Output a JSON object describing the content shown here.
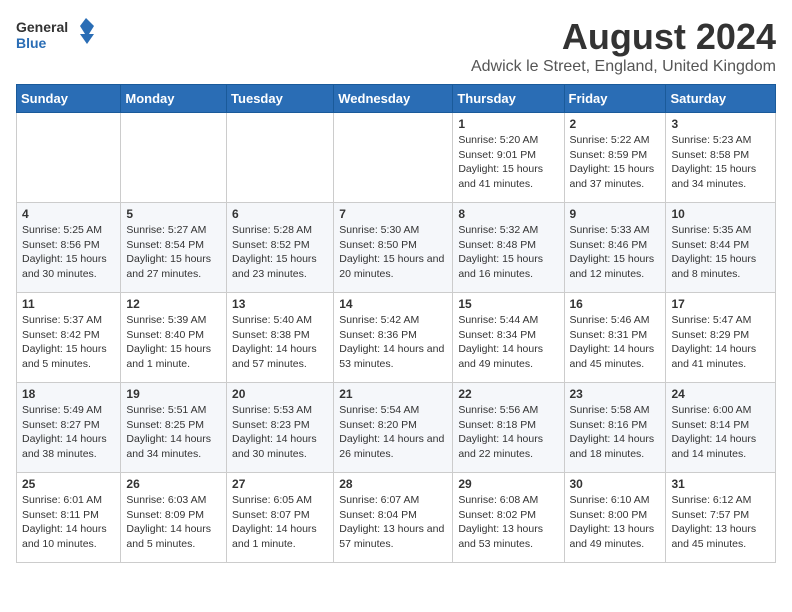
{
  "header": {
    "logo_general": "General",
    "logo_blue": "Blue",
    "main_title": "August 2024",
    "subtitle": "Adwick le Street, England, United Kingdom"
  },
  "calendar": {
    "days_of_week": [
      "Sunday",
      "Monday",
      "Tuesday",
      "Wednesday",
      "Thursday",
      "Friday",
      "Saturday"
    ],
    "weeks": [
      [
        {
          "num": "",
          "info": ""
        },
        {
          "num": "",
          "info": ""
        },
        {
          "num": "",
          "info": ""
        },
        {
          "num": "",
          "info": ""
        },
        {
          "num": "1",
          "info": "Sunrise: 5:20 AM\nSunset: 9:01 PM\nDaylight: 15 hours and 41 minutes."
        },
        {
          "num": "2",
          "info": "Sunrise: 5:22 AM\nSunset: 8:59 PM\nDaylight: 15 hours and 37 minutes."
        },
        {
          "num": "3",
          "info": "Sunrise: 5:23 AM\nSunset: 8:58 PM\nDaylight: 15 hours and 34 minutes."
        }
      ],
      [
        {
          "num": "4",
          "info": "Sunrise: 5:25 AM\nSunset: 8:56 PM\nDaylight: 15 hours and 30 minutes."
        },
        {
          "num": "5",
          "info": "Sunrise: 5:27 AM\nSunset: 8:54 PM\nDaylight: 15 hours and 27 minutes."
        },
        {
          "num": "6",
          "info": "Sunrise: 5:28 AM\nSunset: 8:52 PM\nDaylight: 15 hours and 23 minutes."
        },
        {
          "num": "7",
          "info": "Sunrise: 5:30 AM\nSunset: 8:50 PM\nDaylight: 15 hours and 20 minutes."
        },
        {
          "num": "8",
          "info": "Sunrise: 5:32 AM\nSunset: 8:48 PM\nDaylight: 15 hours and 16 minutes."
        },
        {
          "num": "9",
          "info": "Sunrise: 5:33 AM\nSunset: 8:46 PM\nDaylight: 15 hours and 12 minutes."
        },
        {
          "num": "10",
          "info": "Sunrise: 5:35 AM\nSunset: 8:44 PM\nDaylight: 15 hours and 8 minutes."
        }
      ],
      [
        {
          "num": "11",
          "info": "Sunrise: 5:37 AM\nSunset: 8:42 PM\nDaylight: 15 hours and 5 minutes."
        },
        {
          "num": "12",
          "info": "Sunrise: 5:39 AM\nSunset: 8:40 PM\nDaylight: 15 hours and 1 minute."
        },
        {
          "num": "13",
          "info": "Sunrise: 5:40 AM\nSunset: 8:38 PM\nDaylight: 14 hours and 57 minutes."
        },
        {
          "num": "14",
          "info": "Sunrise: 5:42 AM\nSunset: 8:36 PM\nDaylight: 14 hours and 53 minutes."
        },
        {
          "num": "15",
          "info": "Sunrise: 5:44 AM\nSunset: 8:34 PM\nDaylight: 14 hours and 49 minutes."
        },
        {
          "num": "16",
          "info": "Sunrise: 5:46 AM\nSunset: 8:31 PM\nDaylight: 14 hours and 45 minutes."
        },
        {
          "num": "17",
          "info": "Sunrise: 5:47 AM\nSunset: 8:29 PM\nDaylight: 14 hours and 41 minutes."
        }
      ],
      [
        {
          "num": "18",
          "info": "Sunrise: 5:49 AM\nSunset: 8:27 PM\nDaylight: 14 hours and 38 minutes."
        },
        {
          "num": "19",
          "info": "Sunrise: 5:51 AM\nSunset: 8:25 PM\nDaylight: 14 hours and 34 minutes."
        },
        {
          "num": "20",
          "info": "Sunrise: 5:53 AM\nSunset: 8:23 PM\nDaylight: 14 hours and 30 minutes."
        },
        {
          "num": "21",
          "info": "Sunrise: 5:54 AM\nSunset: 8:20 PM\nDaylight: 14 hours and 26 minutes."
        },
        {
          "num": "22",
          "info": "Sunrise: 5:56 AM\nSunset: 8:18 PM\nDaylight: 14 hours and 22 minutes."
        },
        {
          "num": "23",
          "info": "Sunrise: 5:58 AM\nSunset: 8:16 PM\nDaylight: 14 hours and 18 minutes."
        },
        {
          "num": "24",
          "info": "Sunrise: 6:00 AM\nSunset: 8:14 PM\nDaylight: 14 hours and 14 minutes."
        }
      ],
      [
        {
          "num": "25",
          "info": "Sunrise: 6:01 AM\nSunset: 8:11 PM\nDaylight: 14 hours and 10 minutes."
        },
        {
          "num": "26",
          "info": "Sunrise: 6:03 AM\nSunset: 8:09 PM\nDaylight: 14 hours and 5 minutes."
        },
        {
          "num": "27",
          "info": "Sunrise: 6:05 AM\nSunset: 8:07 PM\nDaylight: 14 hours and 1 minute."
        },
        {
          "num": "28",
          "info": "Sunrise: 6:07 AM\nSunset: 8:04 PM\nDaylight: 13 hours and 57 minutes."
        },
        {
          "num": "29",
          "info": "Sunrise: 6:08 AM\nSunset: 8:02 PM\nDaylight: 13 hours and 53 minutes."
        },
        {
          "num": "30",
          "info": "Sunrise: 6:10 AM\nSunset: 8:00 PM\nDaylight: 13 hours and 49 minutes."
        },
        {
          "num": "31",
          "info": "Sunrise: 6:12 AM\nSunset: 7:57 PM\nDaylight: 13 hours and 45 minutes."
        }
      ]
    ]
  }
}
